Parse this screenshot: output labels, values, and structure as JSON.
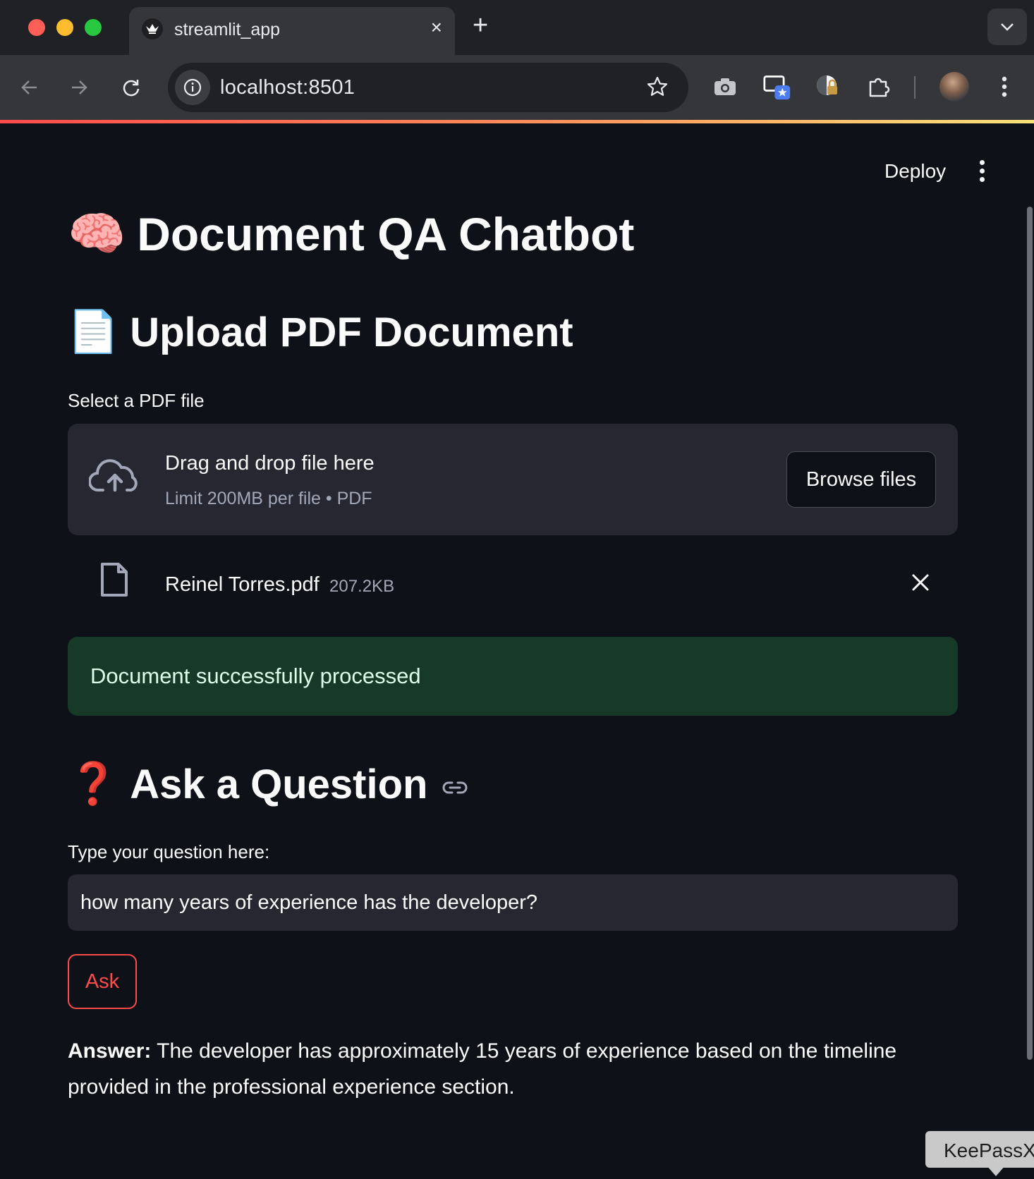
{
  "browser": {
    "tab": {
      "title": "streamlit_app",
      "favicon": "streamlit-crown-icon",
      "close": "×"
    },
    "new_tab": "+",
    "url": "localhost:8501",
    "extensions": [
      "screenshot-camera-icon",
      "picture-in-picture-icon",
      "keepass-lock-icon",
      "extensions-puzzle-icon",
      "profile-avatar"
    ]
  },
  "header": {
    "deploy_label": "Deploy",
    "menu_icon": "more-vertical-icon"
  },
  "main": {
    "title_emoji": "🧠",
    "title": "Document QA Chatbot",
    "upload": {
      "emoji": "📄",
      "heading": "Upload PDF Document",
      "label": "Select a PDF file",
      "dropzone_title": "Drag and drop file here",
      "dropzone_hint": "Limit 200MB per file • PDF",
      "browse_label": "Browse files"
    },
    "file": {
      "name": "Reinel Torres.pdf",
      "size": "207.2KB"
    },
    "success_message": "Document successfully processed",
    "ask": {
      "emoji": "❓",
      "heading": "Ask a Question",
      "label": "Type your question here:",
      "question_value": "how many years of experience has the developer?",
      "button_label": "Ask"
    },
    "answer": {
      "prefix": "Answer:",
      "text": "The developer has approximately 15 years of experience based on the timeline provided in the professional experience section."
    }
  },
  "overlay": {
    "keepass_label": "KeePassX"
  },
  "colors": {
    "background": "#0e1117",
    "surface": "#262730",
    "accent": "#ff4b4b",
    "success_bg": "#173928",
    "success_text": "#dffde9"
  }
}
